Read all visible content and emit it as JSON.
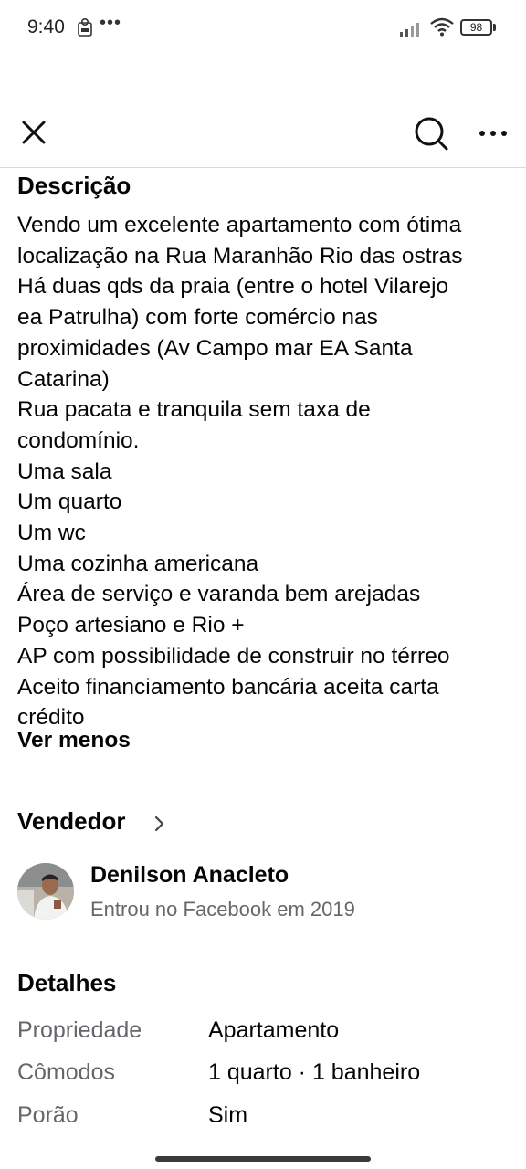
{
  "status_bar": {
    "time": "9:40",
    "dots": "•••",
    "battery": "98"
  },
  "toolbar": {
    "close_icon": "close-icon",
    "search_icon": "search-icon",
    "more_icon": "more-horizontal-icon"
  },
  "description": {
    "heading": "Descrição",
    "lines": [
      "Vendo um excelente apartamento com ótima",
      "localização na Rua Maranhão Rio das ostras",
      "Há duas qds da praia (entre o hotel Vilarejo",
      "ea Patrulha) com forte comércio nas",
      "proximidades (Av Campo mar EA Santa",
      "Catarina)",
      "Rua pacata e tranquila sem taxa de",
      "condomínio.",
      "Uma sala",
      "Um quarto",
      "Um wc",
      "Uma cozinha americana",
      "Área de serviço e varanda bem arejadas",
      "Poço artesiano e Rio +",
      "AP com possibilidade de construir no térreo",
      "Aceito financiamento bancária aceita carta",
      "crédito"
    ],
    "toggle_label": "Ver menos"
  },
  "seller": {
    "heading": "Vendedor",
    "name": "Denilson Anacleto",
    "joined": "Entrou no Facebook em 2019"
  },
  "details": {
    "heading": "Detalhes",
    "rows": [
      {
        "label": "Propriedade",
        "value": "Apartamento"
      },
      {
        "label": "Cômodos",
        "value": "1 quarto · 1 banheiro"
      },
      {
        "label": "Porão",
        "value": "Sim"
      }
    ]
  }
}
